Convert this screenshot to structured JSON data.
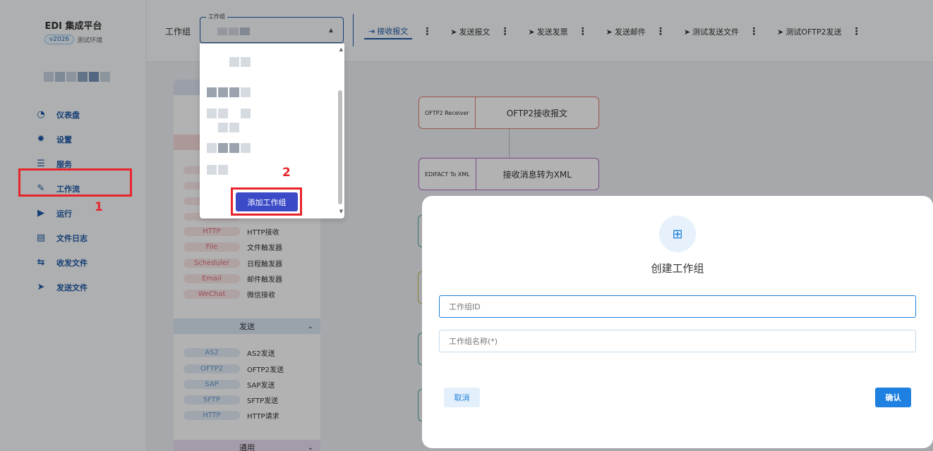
{
  "brand": {
    "title": "EDI 集成平台",
    "version": "v2026",
    "env": "测试环境"
  },
  "sidebar": {
    "items": [
      {
        "label": "仪表盘",
        "icon": "dashboard-icon"
      },
      {
        "label": "设置",
        "icon": "gear-icon"
      },
      {
        "label": "服务",
        "icon": "server-icon"
      },
      {
        "label": "工作流",
        "icon": "pencil-icon"
      },
      {
        "label": "运行",
        "icon": "play-icon"
      },
      {
        "label": "文件日志",
        "icon": "file-log-icon"
      },
      {
        "label": "收发文件",
        "icon": "transfer-icon"
      },
      {
        "label": "发送文件",
        "icon": "send-icon"
      }
    ]
  },
  "annotations": {
    "step1": "1",
    "step2": "2"
  },
  "header": {
    "workgroup_label": "工作组",
    "workgroup_select_legend": "工作组",
    "tabs": [
      {
        "label": "接收报文",
        "active": true
      },
      {
        "label": "发送报文"
      },
      {
        "label": "发送发票"
      },
      {
        "label": "发送邮件"
      },
      {
        "label": "测试发送文件"
      },
      {
        "label": "测试OFTP2发送"
      }
    ]
  },
  "dropdown": {
    "add_button": "添加工作组"
  },
  "palette": {
    "receive_items": [
      {
        "tag": "HTTP",
        "label": "HTTP接收"
      },
      {
        "tag": "File",
        "label": "文件触发器"
      },
      {
        "tag": "Scheduler",
        "label": "日程触发器"
      },
      {
        "tag": "Email",
        "label": "邮件触发器"
      },
      {
        "tag": "WeChat",
        "label": "微信接收"
      }
    ],
    "send_group": "发送",
    "send_items": [
      {
        "tag": "AS2",
        "label": "AS2发送"
      },
      {
        "tag": "OFTP2",
        "label": "OFTP2发送"
      },
      {
        "tag": "SAP",
        "label": "SAP发送"
      },
      {
        "tag": "SFTP",
        "label": "SFTP发送"
      },
      {
        "tag": "HTTP",
        "label": "HTTP请求"
      }
    ],
    "common_group": "通用"
  },
  "flow": {
    "nodes": [
      {
        "type": "OFTP2 Receiver",
        "label": "OFTP2接收报文",
        "color": "#e07a6e"
      },
      {
        "type": "EDIFACT To XML",
        "label": "接收消息转为XML",
        "color": "#b06ac4"
      }
    ]
  },
  "modal": {
    "title": "创建工作组",
    "field_id_placeholder": "工作组ID",
    "field_name_placeholder": "工作组名称(*)",
    "cancel": "取消",
    "confirm": "确认"
  },
  "colors": {
    "primary": "#1e5aa8",
    "accent": "#1e80e0",
    "highlight": "#e8242b",
    "add_button": "#3b4bc8"
  }
}
